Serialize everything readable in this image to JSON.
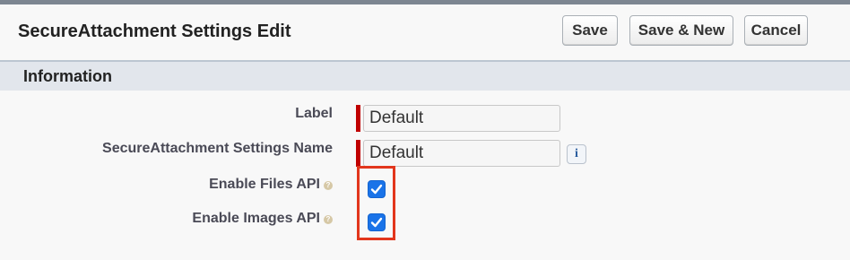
{
  "header": {
    "title": "SecureAttachment Settings Edit",
    "buttons": {
      "save": "Save",
      "save_new": "Save & New",
      "cancel": "Cancel"
    }
  },
  "section": {
    "title": "Information"
  },
  "fields": {
    "label": {
      "label": "Label",
      "value": "Default",
      "required": true
    },
    "name": {
      "label": "SecureAttachment Settings Name",
      "value": "Default",
      "required": true,
      "info_glyph": "i"
    },
    "files_api": {
      "label": "Enable Files API",
      "checked": true
    },
    "images_api": {
      "label": "Enable Images API",
      "checked": true
    }
  },
  "icons": {
    "help": "help-icon",
    "info": "info-icon",
    "check": "checkmark-icon"
  },
  "colors": {
    "required": "#c00000",
    "checkbox": "#1a73e8",
    "highlight": "#e2361c",
    "section_bg": "#e2e6ec"
  }
}
